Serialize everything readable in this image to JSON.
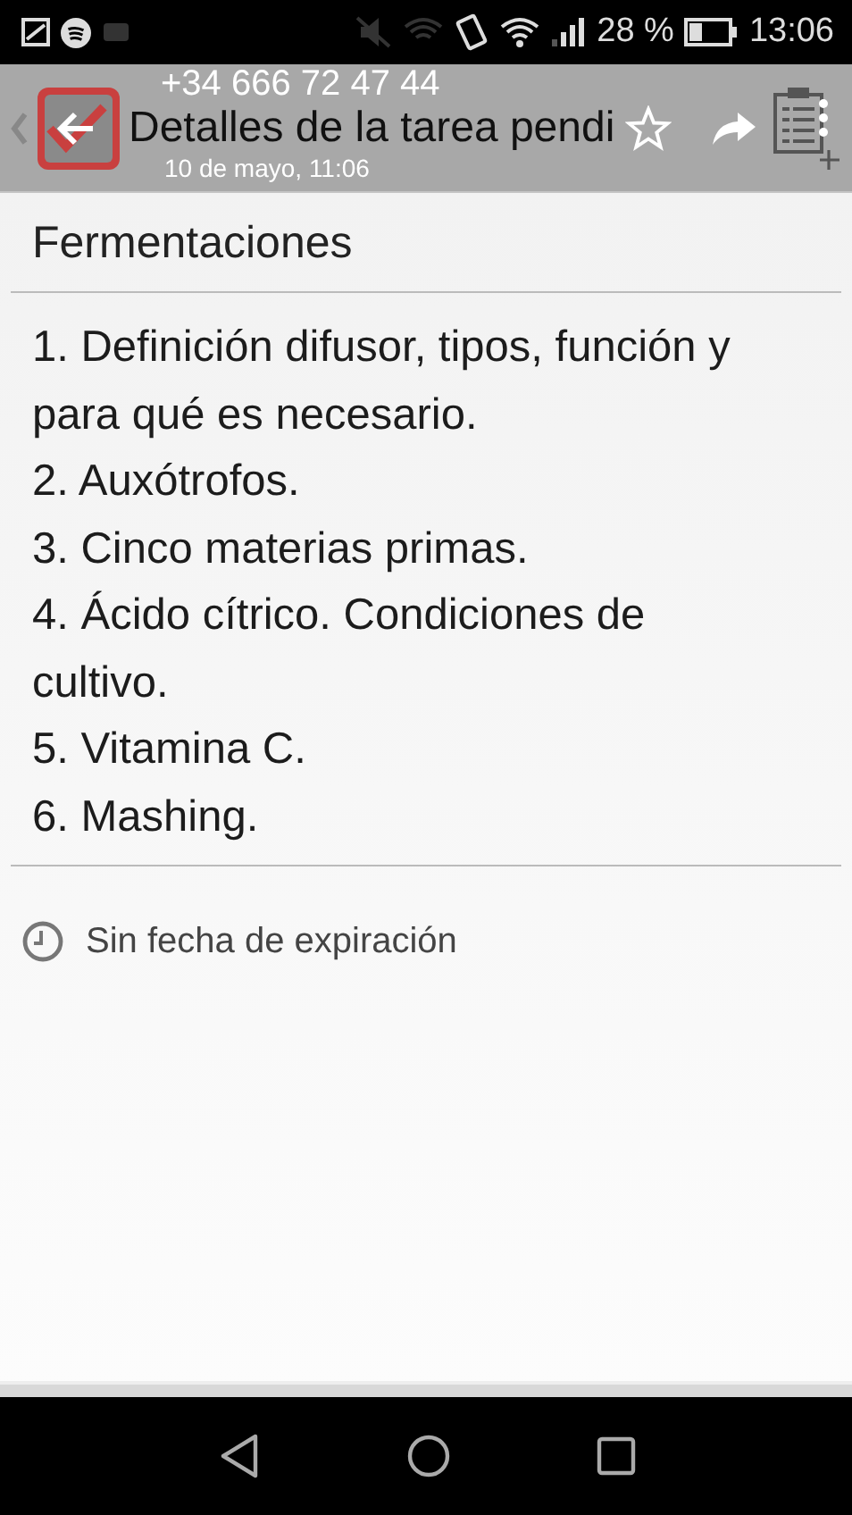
{
  "status_bar": {
    "battery": "28 %",
    "time": "13:06"
  },
  "toolbar": {
    "title": "Detalles de la tarea pendi",
    "notification": {
      "sender": "+34 666 72 47 44",
      "time": "10 de mayo, 11:06"
    }
  },
  "task": {
    "title": "Fermentaciones",
    "description": [
      "1. Definición difusor, tipos, función y para qué es necesario.",
      "2. Auxótrofos.",
      "3. Cinco materias primas.",
      "4. Ácido cítrico. Condiciones de cultivo.",
      "5. Vitamina C.",
      "6. Mashing."
    ],
    "due": "Sin fecha de expiración"
  }
}
